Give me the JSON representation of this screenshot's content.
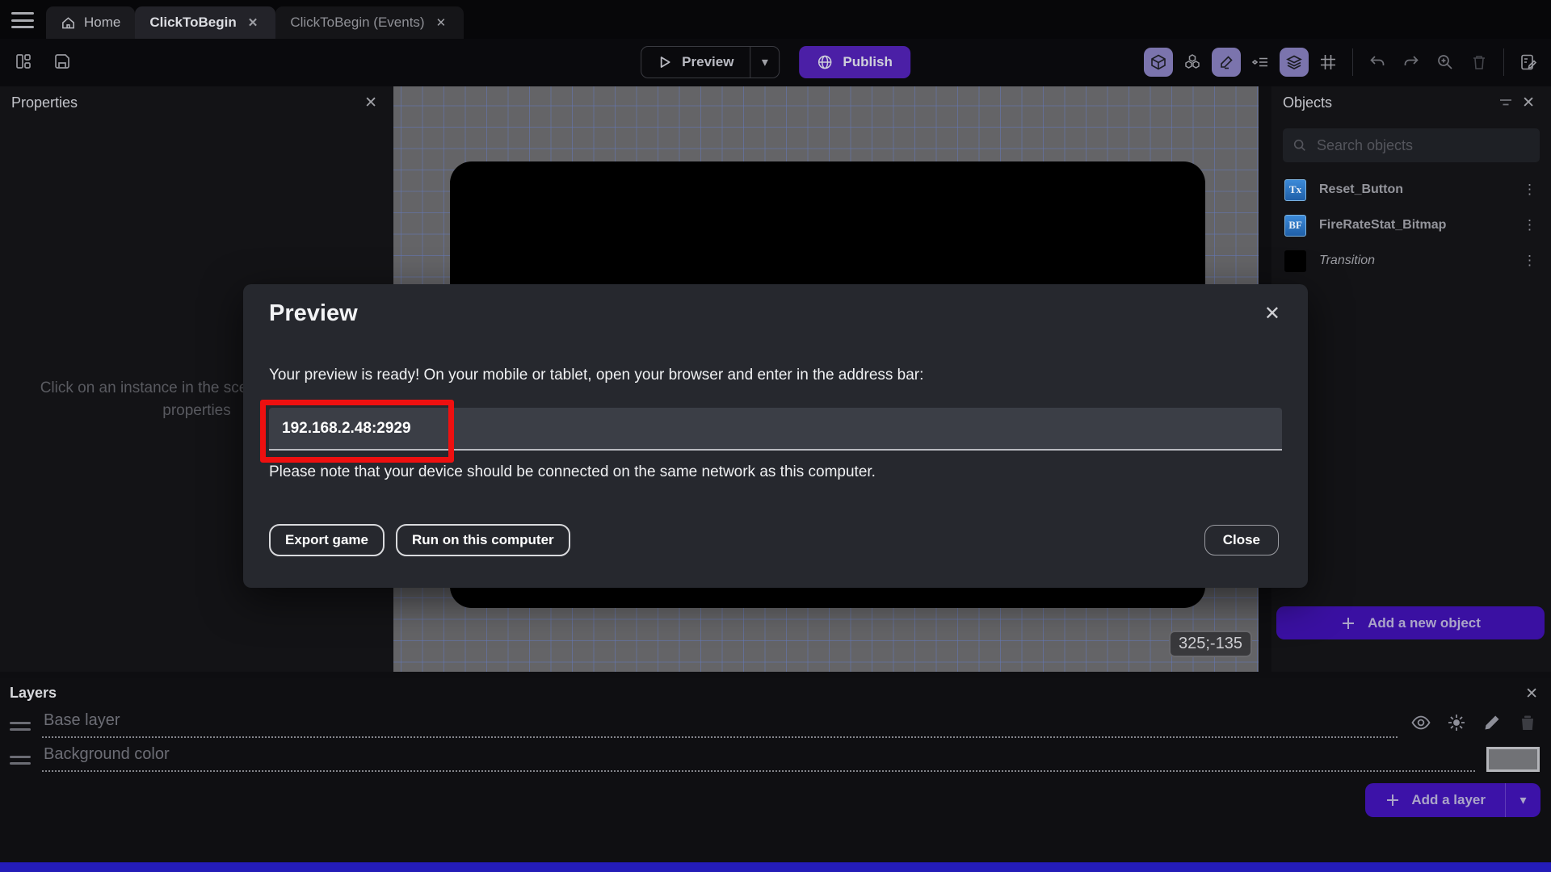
{
  "tabs": {
    "home": "Home",
    "scene": "ClickToBegin",
    "events": "ClickToBegin (Events)"
  },
  "toolbar": {
    "preview_label": "Preview",
    "publish_label": "Publish"
  },
  "properties": {
    "title": "Properties",
    "empty_text": "Click on an instance in the scene to display its properties"
  },
  "objects": {
    "title": "Objects",
    "search_placeholder": "Search objects",
    "items": [
      {
        "name": "Reset_Button",
        "icon_label": "Tx",
        "icon_type": "text-object"
      },
      {
        "name": "FireRateStat_Bitmap",
        "icon_label": "BF",
        "icon_type": "bitmap-font-object"
      },
      {
        "name": "Transition",
        "icon_label": "",
        "icon_type": "black-square"
      }
    ],
    "add_button_label": "Add a new object"
  },
  "canvas": {
    "coordinates": "325;-135"
  },
  "modal": {
    "title": "Preview",
    "ready_text": "Your preview is ready! On your mobile or tablet, open your browser and enter in the address bar:",
    "address_value": "192.168.2.48:2929",
    "note_text": "Please note that your device should be connected on the same network as this computer.",
    "export_label": "Export game",
    "run_label": "Run on this computer",
    "close_label": "Close"
  },
  "layers": {
    "title": "Layers",
    "items": [
      {
        "name": "Base layer"
      },
      {
        "name": "Background color"
      }
    ],
    "add_button_label": "Add a layer"
  },
  "colors": {
    "accent_purple": "#4b1fa6",
    "deep_purple_button": "#3a10a2",
    "active_toggle": "#7b74ad",
    "annotation_red": "#ee1010",
    "canvas_gray": "#646467",
    "grid_blue": "#6478b9",
    "modal_bg": "#26282e",
    "bottom_strip_blue": "#241cb8",
    "object_icon_blue": "#2d7dc8"
  }
}
